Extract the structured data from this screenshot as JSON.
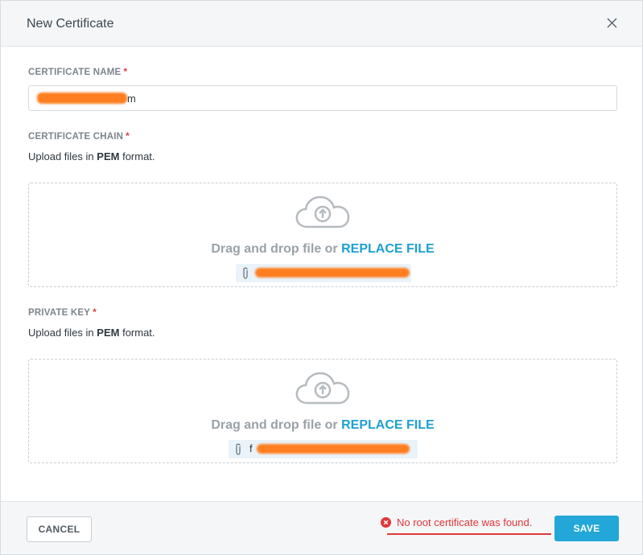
{
  "dialog": {
    "title": "New Certificate",
    "close_icon": "close-icon"
  },
  "certificate_name": {
    "label": "CERTIFICATE NAME",
    "required_mark": "*",
    "value_visible_suffix": "m",
    "value_redacted": true
  },
  "certificate_chain": {
    "label": "CERTIFICATE CHAIN",
    "required_mark": "*",
    "hint_prefix": "Upload files in",
    "hint_format": "PEM",
    "hint_suffix": "format.",
    "drop_text": "Drag and drop file or",
    "drop_link": "REPLACE FILE",
    "upload_icon": "cloud-upload-icon",
    "file_icon": "paperclip-icon",
    "file_name_redacted": true
  },
  "private_key": {
    "label": "PRIVATE KEY",
    "required_mark": "*",
    "hint_prefix": "Upload files in",
    "hint_format": "PEM",
    "hint_suffix": "format.",
    "drop_text": "Drag and drop file or",
    "drop_link": "REPLACE FILE",
    "upload_icon": "cloud-upload-icon",
    "file_icon": "paperclip-icon",
    "file_name_visible_prefix": "f",
    "file_name_redacted": true
  },
  "footer": {
    "cancel_label": "CANCEL",
    "error_message": "No root certificate was found.",
    "error_icon": "error-circle-icon",
    "save_label": "SAVE"
  },
  "colors": {
    "accent": "#22a7d8",
    "link": "#1ea0d0",
    "error": "#e0373b",
    "required": "#e0373b",
    "redaction": "#ff7e1f"
  }
}
